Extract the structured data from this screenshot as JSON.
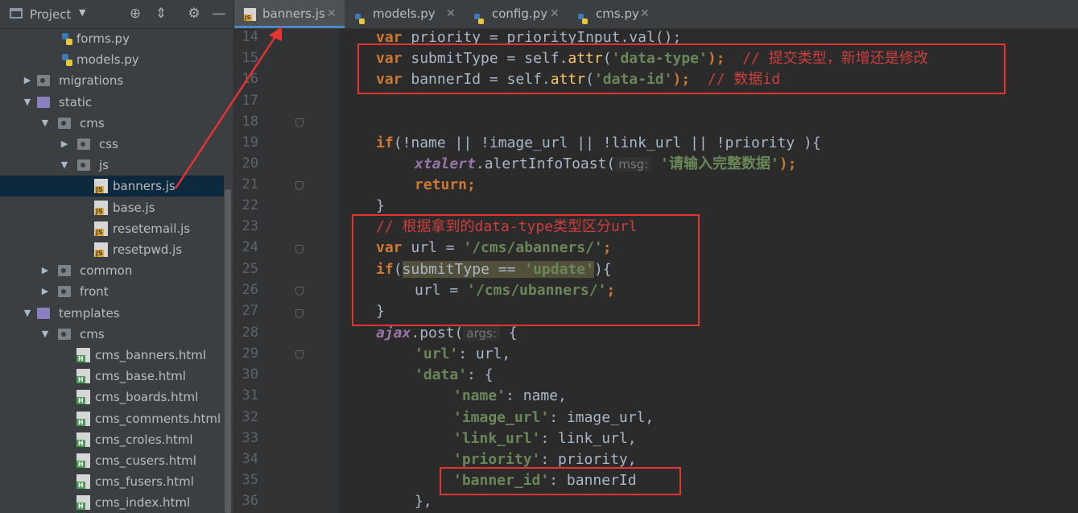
{
  "sidebar": {
    "title": "Project",
    "tree": [
      {
        "label": "forms.py",
        "kind": "py",
        "depth": 3
      },
      {
        "label": "models.py",
        "kind": "py",
        "depth": 3
      },
      {
        "label": "migrations",
        "kind": "folder",
        "depth": 1,
        "arrow": "▶"
      },
      {
        "label": "static",
        "kind": "pfolder",
        "depth": 1,
        "arrow": "▼"
      },
      {
        "label": "cms",
        "kind": "folder",
        "depth": 2,
        "arrow": "▼"
      },
      {
        "label": "css",
        "kind": "folder",
        "depth": 3,
        "arrow": "▶"
      },
      {
        "label": "js",
        "kind": "folder",
        "depth": 3,
        "arrow": "▼"
      },
      {
        "label": "banners.js",
        "kind": "js",
        "depth": 4,
        "selected": true
      },
      {
        "label": "base.js",
        "kind": "js",
        "depth": 4
      },
      {
        "label": "resetemail.js",
        "kind": "js",
        "depth": 4
      },
      {
        "label": "resetpwd.js",
        "kind": "js",
        "depth": 4
      },
      {
        "label": "common",
        "kind": "folder",
        "depth": 2,
        "arrow": "▶"
      },
      {
        "label": "front",
        "kind": "folder",
        "depth": 2,
        "arrow": "▶"
      },
      {
        "label": "templates",
        "kind": "pfolder",
        "depth": 1,
        "arrow": "▼"
      },
      {
        "label": "cms",
        "kind": "folder",
        "depth": 2,
        "arrow": "▼"
      },
      {
        "label": "cms_banners.html",
        "kind": "html",
        "depth": 3
      },
      {
        "label": "cms_base.html",
        "kind": "html",
        "depth": 3
      },
      {
        "label": "cms_boards.html",
        "kind": "html",
        "depth": 3
      },
      {
        "label": "cms_comments.html",
        "kind": "html",
        "depth": 3
      },
      {
        "label": "cms_croles.html",
        "kind": "html",
        "depth": 3
      },
      {
        "label": "cms_cusers.html",
        "kind": "html",
        "depth": 3
      },
      {
        "label": "cms_fusers.html",
        "kind": "html",
        "depth": 3
      },
      {
        "label": "cms_index.html",
        "kind": "html",
        "depth": 3
      }
    ]
  },
  "tabs": [
    {
      "label": "banners.js",
      "icon": "js",
      "active": true
    },
    {
      "label": "models.py",
      "icon": "py"
    },
    {
      "label": "config.py",
      "icon": "py"
    },
    {
      "label": "cms.py",
      "icon": "py"
    }
  ],
  "line_numbers": [
    "14",
    "15",
    "16",
    "17",
    "18",
    "19",
    "20",
    "21",
    "22",
    "23",
    "24",
    "25",
    "26",
    "27",
    "28",
    "29",
    "30",
    "31",
    "32",
    "33",
    "34",
    "35",
    "36"
  ],
  "code": {
    "l14": {
      "kw": "var",
      "text": " priority = priorityInput.val();"
    },
    "l15": {
      "kw": "var",
      "a": " submitType = self.",
      "fn": "attr",
      "b": "(",
      "str": "'data-type'",
      "c": ");  ",
      "cm": "// 提交类型，新增还是修改"
    },
    "l16": {
      "kw": "var",
      "a": " bannerId = self.",
      "fn": "attr",
      "b": "(",
      "str": "'data-id'",
      "c": ");  ",
      "cm": "// 数据id"
    },
    "l19": {
      "kw": "if",
      "text": "(!name || !image_url || !link_url || !priority ){"
    },
    "l20": {
      "gl": "xtalert",
      "a": ".alertInfoToast(",
      "hint": "msg:",
      "str": "'请输入完整数据'",
      "b": ");"
    },
    "l21": {
      "kw": "return",
      "text": ";"
    },
    "l22": {
      "text": "}"
    },
    "l23": {
      "cm": "// 根据拿到的data-type类型区分url"
    },
    "l24": {
      "kw": "var",
      "a": " url = ",
      "str": "'/cms/abanners/'",
      "b": ";"
    },
    "l25": {
      "kw": "if",
      "a": "(",
      "hl": "submitType == ",
      "str": "'update'",
      "b": "){"
    },
    "l26": {
      "a": "url = ",
      "str": "'/cms/ubanners/'",
      "b": ";"
    },
    "l27": {
      "text": "}"
    },
    "l28": {
      "gl": "ajax",
      "a": ".post(",
      "hint": "args:",
      "b": "{"
    },
    "l29": {
      "str": "'url'",
      "a": ": url,"
    },
    "l30": {
      "str": "'data'",
      "a": ": {"
    },
    "l31": {
      "str": "'name'",
      "a": ": name,"
    },
    "l32": {
      "str": "'image_url'",
      "a": ": image_url,"
    },
    "l33": {
      "str": "'link_url'",
      "a": ": link_url,"
    },
    "l34": {
      "str": "'priority'",
      "a": ": priority,"
    },
    "l35": {
      "str": "'banner_id'",
      "a": ": bannerId"
    },
    "l36": {
      "text": "},"
    }
  },
  "colors": {
    "annotation": "#e53333",
    "selection": "#0d293e",
    "accent": "#4a88c7"
  }
}
